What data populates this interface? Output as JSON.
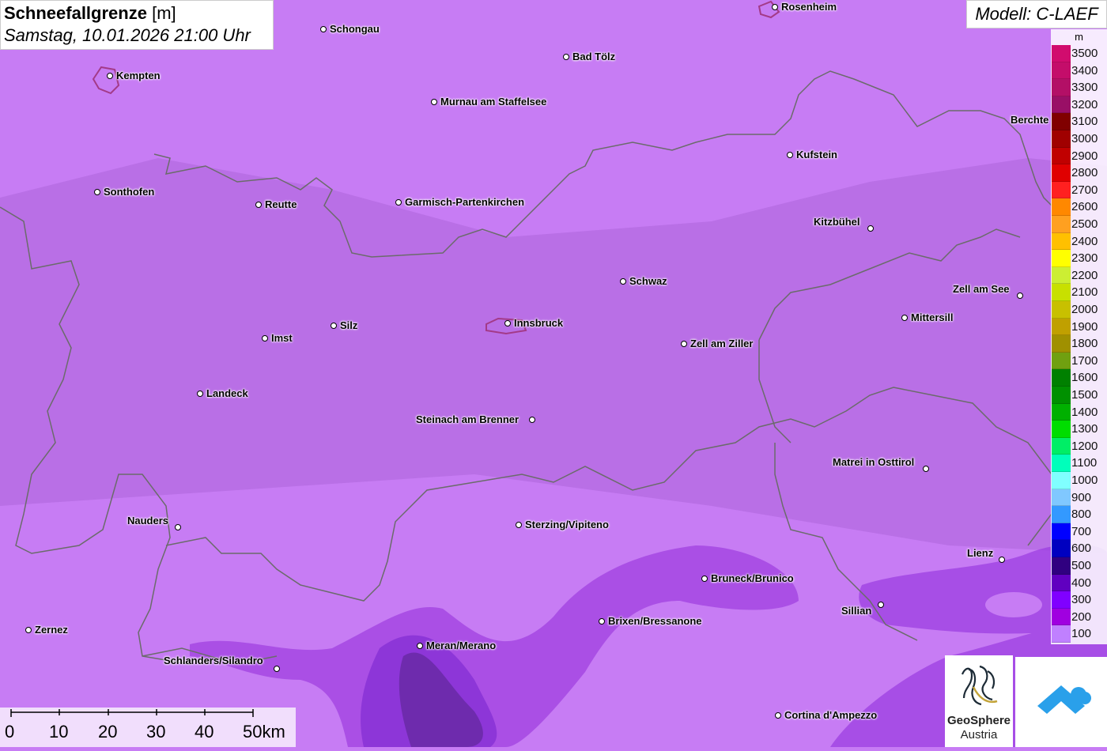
{
  "title": {
    "main": "Schneefallgrenze",
    "unit": "[m]",
    "datetime": "Samstag, 10.01.2026 21:00 Uhr"
  },
  "model": "Modell: C-LAEF",
  "legend": {
    "unit": "m",
    "levels": [
      {
        "label": "3500",
        "color": "#d10c6e"
      },
      {
        "label": "3400",
        "color": "#c40d6a"
      },
      {
        "label": "3300",
        "color": "#b30f66"
      },
      {
        "label": "3200",
        "color": "#990f66"
      },
      {
        "label": "3100",
        "color": "#800000"
      },
      {
        "label": "3000",
        "color": "#a00000"
      },
      {
        "label": "2900",
        "color": "#c00000"
      },
      {
        "label": "2800",
        "color": "#e00000"
      },
      {
        "label": "2700",
        "color": "#ff2020"
      },
      {
        "label": "2600",
        "color": "#ff8800"
      },
      {
        "label": "2500",
        "color": "#ffa020"
      },
      {
        "label": "2400",
        "color": "#ffc000"
      },
      {
        "label": "2300",
        "color": "#ffff00"
      },
      {
        "label": "2200",
        "color": "#ccee33"
      },
      {
        "label": "2100",
        "color": "#c8e000"
      },
      {
        "label": "2000",
        "color": "#c8c000"
      },
      {
        "label": "1900",
        "color": "#c0a000"
      },
      {
        "label": "1800",
        "color": "#a09000"
      },
      {
        "label": "1700",
        "color": "#70a010"
      },
      {
        "label": "1600",
        "color": "#008000"
      },
      {
        "label": "1500",
        "color": "#009000"
      },
      {
        "label": "1400",
        "color": "#00b000"
      },
      {
        "label": "1300",
        "color": "#00dd00"
      },
      {
        "label": "1200",
        "color": "#00ee66"
      },
      {
        "label": "1100",
        "color": "#00ffbb"
      },
      {
        "label": "1000",
        "color": "#80ffff"
      },
      {
        "label": "900",
        "color": "#80c8ff"
      },
      {
        "label": "800",
        "color": "#3399ff"
      },
      {
        "label": "700",
        "color": "#0000ff"
      },
      {
        "label": "600",
        "color": "#0000c0"
      },
      {
        "label": "500",
        "color": "#300080"
      },
      {
        "label": "400",
        "color": "#6000c0"
      },
      {
        "label": "300",
        "color": "#8000ff"
      },
      {
        "label": "200",
        "color": "#a000e0"
      },
      {
        "label": "100",
        "color": "#c080ff"
      }
    ]
  },
  "cities": [
    "Rosenheim",
    "Schongau",
    "Kempten",
    "Bad Tölz",
    "Murnau am Staffelsee",
    "Berchte",
    "Kufstein",
    "Sonthofen",
    "Reutte",
    "Garmisch-Partenkirchen",
    "Kitzbühel",
    "Schwaz",
    "Zell am See",
    "Mittersill",
    "Innsbruck",
    "Silz",
    "Imst",
    "Zell am Ziller",
    "Landeck",
    "Steinach am Brenner",
    "Matrei in Osttirol",
    "Nauders",
    "Sterzing/Vipiteno",
    "Lienz",
    "Bruneck/Brunico",
    "Sillian",
    "Brixen/Bressanone",
    "Zernez",
    "Meran/Merano",
    "Schlanders/Silandro",
    "Cortina d'Ampezzo"
  ],
  "scale": {
    "ticks": [
      "0",
      "10",
      "20",
      "30",
      "40",
      "50km"
    ]
  },
  "logos": {
    "geosphere_line1": "GeoSphere",
    "geosphere_line2": "Austria"
  }
}
